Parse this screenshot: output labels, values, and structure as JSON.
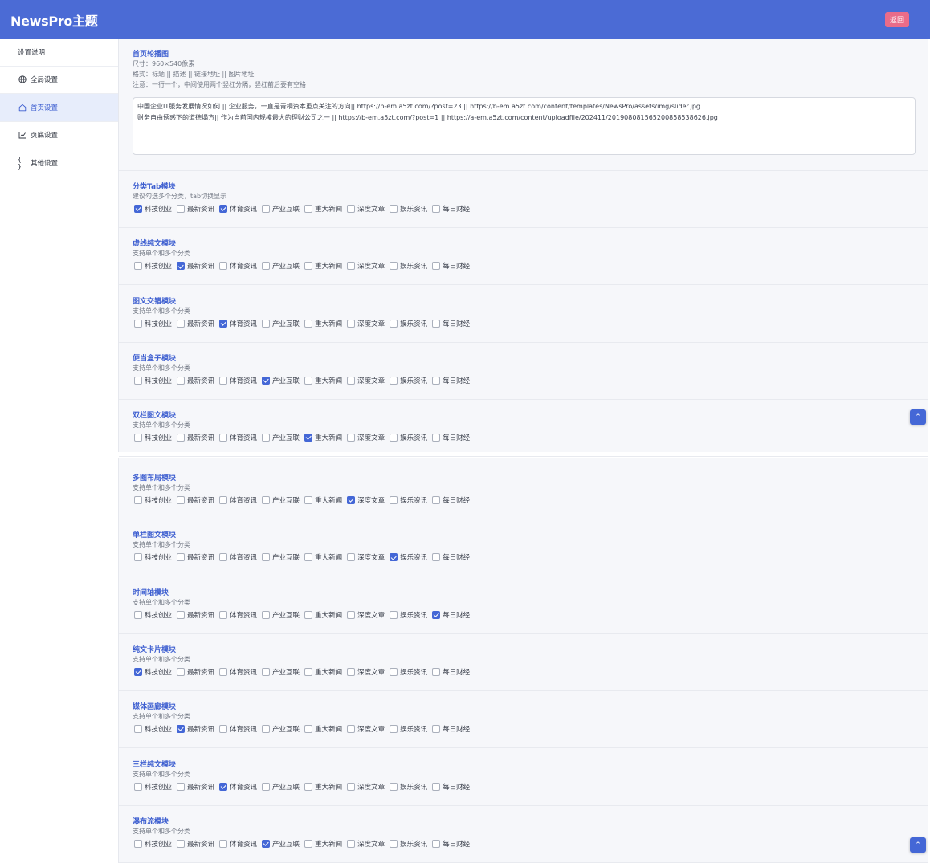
{
  "header": {
    "title": "NewsPro主题",
    "back_label": "返回"
  },
  "sidebar": {
    "items": [
      {
        "label": "设置说明",
        "icon": "none",
        "active": false
      },
      {
        "label": "全局设置",
        "icon": "globe-icon",
        "active": false
      },
      {
        "label": "首页设置",
        "icon": "home-icon",
        "active": true
      },
      {
        "label": "页底设置",
        "icon": "chart-line-icon",
        "active": false
      },
      {
        "label": "其他设置",
        "icon": "braces-icon",
        "active": false
      }
    ]
  },
  "slider": {
    "title": "首页轮播图",
    "desc1": "尺寸：960×540像素",
    "desc2": "格式：标题 || 描述 || 链接地址 || 图片地址",
    "desc3": "注意：一行一个，中间使用两个竖杠分隔，竖杠前后要有空格",
    "value": "中国企业IT服务发展情况如何 || 企业服务，一直是青桐资本重点关注的方向|| https://b-em.a5zt.com/?post=23 || https://b-em.a5zt.com/content/templates/NewsPro/assets/img/slider.jpg\n财务自由诱惑下的道德塌方|| 作为当前国内规模最大的理财公司之一 || https://b-em.a5zt.com/?post=1 || https://a-em.a5zt.com/content/uploadfile/202411/20190808156520085853862​6.jpg"
  },
  "categories": [
    "科技创业",
    "最新资讯",
    "体育资讯",
    "产业互联",
    "重大新闻",
    "深度文章",
    "娱乐资讯",
    "每日财经"
  ],
  "modules": [
    {
      "title": "分类Tab模块",
      "desc": "建议勾选多个分类，tab切换显示",
      "checked": [
        0,
        2
      ]
    },
    {
      "title": "虚线纯文模块",
      "desc": "支持单个和多个分类",
      "checked": [
        1
      ]
    },
    {
      "title": "图文交错模块",
      "desc": "支持单个和多个分类",
      "checked": [
        2
      ]
    },
    {
      "title": "便当盒子模块",
      "desc": "支持单个和多个分类",
      "checked": [
        3
      ]
    },
    {
      "title": "双栏图文模块",
      "desc": "支持单个和多个分类",
      "checked": [
        4
      ]
    },
    {
      "title": "多图布局模块",
      "desc": "支持单个和多个分类",
      "checked": [
        5
      ]
    },
    {
      "title": "单栏图文模块",
      "desc": "支持单个和多个分类",
      "checked": [
        6
      ]
    },
    {
      "title": "时间轴模块",
      "desc": "支持单个和多个分类",
      "checked": [
        7
      ]
    },
    {
      "title": "纯文卡片模块",
      "desc": "支持单个和多个分类",
      "checked": [
        0
      ]
    },
    {
      "title": "媒体画廊模块",
      "desc": "支持单个和多个分类",
      "checked": [
        1
      ]
    },
    {
      "title": "三栏纯文模块",
      "desc": "支持单个和多个分类",
      "checked": [
        2
      ]
    },
    {
      "title": "瀑布流模块",
      "desc": "支持单个和多个分类",
      "checked": [
        3
      ]
    }
  ],
  "to_top_label": "⌃",
  "colors": {
    "header": "#4b6bd5",
    "back_button": "#ea6c89",
    "accent": "#4467d6",
    "panel": "#f6f7fa"
  }
}
